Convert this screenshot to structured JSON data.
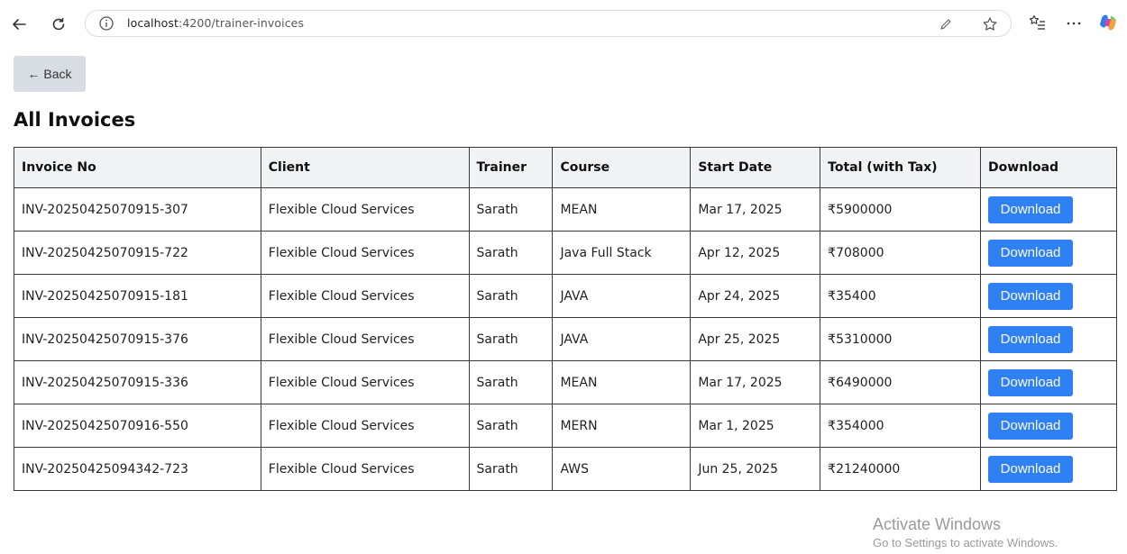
{
  "browser": {
    "url_host": "localhost",
    "url_rest": ":4200/trainer-invoices"
  },
  "page": {
    "back_label": "← Back",
    "title": "All Invoices"
  },
  "table": {
    "headers": [
      "Invoice No",
      "Client",
      "Trainer",
      "Course",
      "Start Date",
      "Total (with Tax)",
      "Download"
    ],
    "rows": [
      {
        "invoice": "INV-20250425070915-307",
        "client": "Flexible Cloud Services",
        "trainer": "Sarath",
        "course": "MEAN",
        "start": "Mar 17, 2025",
        "total": "₹5900000",
        "action": "Download"
      },
      {
        "invoice": "INV-20250425070915-722",
        "client": "Flexible Cloud Services",
        "trainer": "Sarath",
        "course": "Java Full Stack",
        "start": "Apr 12, 2025",
        "total": "₹708000",
        "action": "Download"
      },
      {
        "invoice": "INV-20250425070915-181",
        "client": "Flexible Cloud Services",
        "trainer": "Sarath",
        "course": "JAVA",
        "start": "Apr 24, 2025",
        "total": "₹35400",
        "action": "Download"
      },
      {
        "invoice": "INV-20250425070915-376",
        "client": "Flexible Cloud Services",
        "trainer": "Sarath",
        "course": "JAVA",
        "start": "Apr 25, 2025",
        "total": "₹5310000",
        "action": "Download"
      },
      {
        "invoice": "INV-20250425070915-336",
        "client": "Flexible Cloud Services",
        "trainer": "Sarath",
        "course": "MEAN",
        "start": "Mar 17, 2025",
        "total": "₹6490000",
        "action": "Download"
      },
      {
        "invoice": "INV-20250425070916-550",
        "client": "Flexible Cloud Services",
        "trainer": "Sarath",
        "course": "MERN",
        "start": "Mar 1, 2025",
        "total": "₹354000",
        "action": "Download"
      },
      {
        "invoice": "INV-20250425094342-723",
        "client": "Flexible Cloud Services",
        "trainer": "Sarath",
        "course": "AWS",
        "start": "Jun 25, 2025",
        "total": "₹21240000",
        "action": "Download"
      }
    ]
  },
  "watermark": {
    "line1": "Activate Windows",
    "line2": "Go to Settings to activate Windows."
  },
  "colors": {
    "download_button": "#2f7ff5",
    "back_button": "#d8dde3",
    "header_background": "#f1f2f4"
  }
}
